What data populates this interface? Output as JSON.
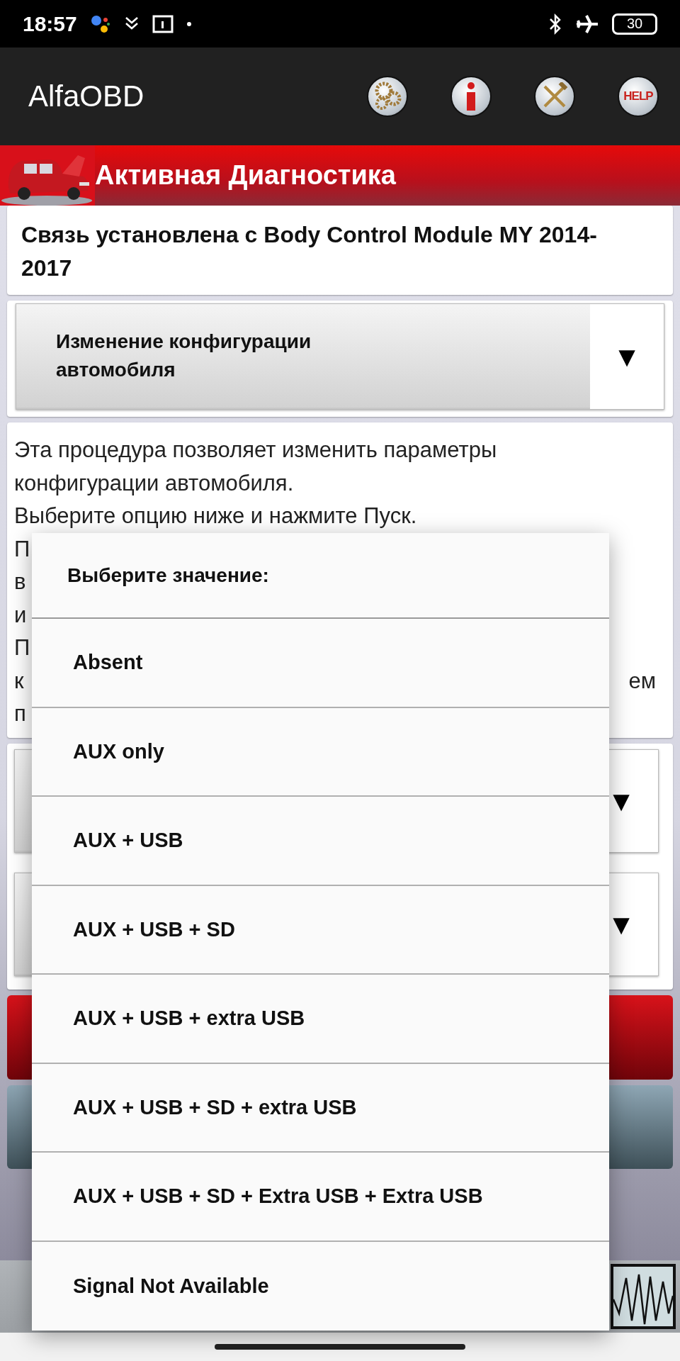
{
  "status_bar": {
    "time": "18:57",
    "battery": "30"
  },
  "app_bar": {
    "title": "AlfaOBD",
    "actions": [
      {
        "kind": "gear"
      },
      {
        "kind": "info"
      },
      {
        "kind": "tools"
      },
      {
        "kind": "help",
        "label": "HELP"
      }
    ]
  },
  "banner": {
    "title": "Активная Диагностика"
  },
  "connection": {
    "text": "Связь установлена с Body Control Module MY 2014-2017"
  },
  "procedure_select": {
    "value": "Изменение конфигурации автомобиля",
    "arrow": "▼"
  },
  "description": {
    "lines": [
      {
        "left": "Эта процедура позволяет изменить параметры"
      },
      {
        "left": "конфигурации автомобиля."
      },
      {
        "left": "Выберите опцию ниже и нажмите Пуск."
      },
      {
        "left": "П"
      },
      {
        "left": "в"
      },
      {
        "left": "и"
      },
      {
        "left": "П"
      },
      {
        "left": "к",
        "right": "ем"
      },
      {
        "left": "п"
      }
    ]
  },
  "option_selects": [
    {
      "arrow": "▼"
    },
    {
      "arrow": "▼"
    }
  ],
  "dialog": {
    "title": "Выберите значение:",
    "options": [
      "Absent",
      "AUX only",
      "AUX + USB",
      "AUX + USB + SD",
      "AUX + USB + extra USB",
      "AUX + USB + SD + extra USB",
      "AUX + USB + SD + Extra USB + Extra USB",
      "Signal Not Available"
    ]
  }
}
